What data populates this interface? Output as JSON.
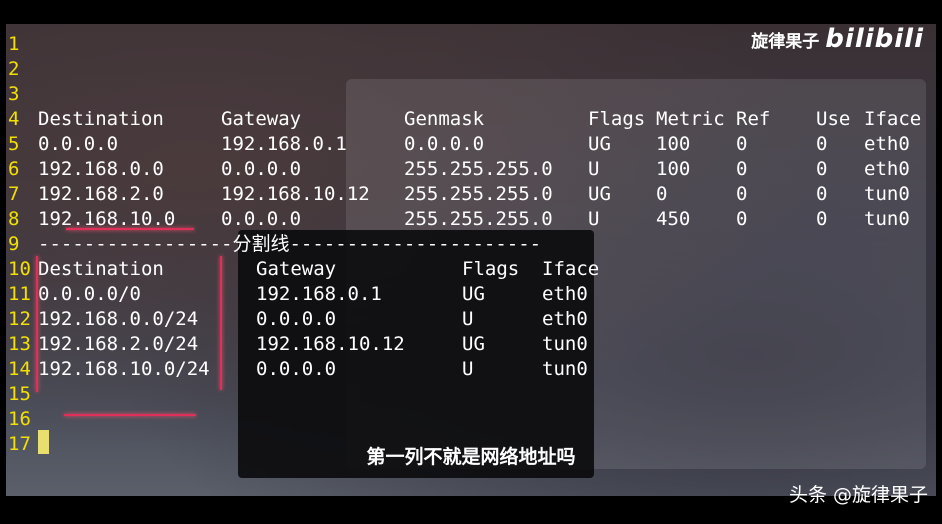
{
  "watermark": {
    "author": "旋律果子",
    "brand": "bilibili"
  },
  "subtitle": "第一列不就是网络地址吗",
  "credit": "头条 @旋律果子",
  "colors": {
    "line_number": "#f2e000",
    "text": "#ffffff",
    "mark": "#e0305a",
    "cursor": "#e8df6e"
  },
  "lines": [
    {
      "n": "1",
      "cells": []
    },
    {
      "n": "2",
      "cells": []
    },
    {
      "n": "3",
      "cells": []
    },
    {
      "n": "4",
      "cells": [
        "Destination",
        "Gateway",
        "Genmask",
        "Flags",
        "Metric",
        "Ref",
        "Use",
        "Iface"
      ]
    },
    {
      "n": "5",
      "cells": [
        "0.0.0.0",
        "192.168.0.1",
        "0.0.0.0",
        "UG",
        "100",
        "0",
        "0",
        "eth0"
      ]
    },
    {
      "n": "6",
      "cells": [
        "192.168.0.0",
        "0.0.0.0",
        "255.255.255.0",
        "U",
        "100",
        "0",
        "0",
        "eth0"
      ]
    },
    {
      "n": "7",
      "cells": [
        "192.168.2.0",
        "192.168.10.12",
        "255.255.255.0",
        "UG",
        "0",
        "0",
        "0",
        "tun0"
      ]
    },
    {
      "n": "8",
      "cells": [
        "192.168.10.0",
        "0.0.0.0",
        "255.255.255.0",
        "U",
        "450",
        "0",
        "0",
        "tun0"
      ]
    },
    {
      "n": "9",
      "cells": [
        "-----------------分割线----------------------"
      ]
    },
    {
      "n": "10",
      "cells": [
        "Destination",
        "Gateway",
        "Flags",
        "Iface"
      ]
    },
    {
      "n": "11",
      "cells": [
        "0.0.0.0/0",
        "192.168.0.1",
        "UG",
        "eth0"
      ]
    },
    {
      "n": "12",
      "cells": [
        "192.168.0.0/24",
        "0.0.0.0",
        "U",
        "eth0"
      ]
    },
    {
      "n": "13",
      "cells": [
        "192.168.2.0/24",
        "192.168.10.12",
        "UG",
        "tun0"
      ]
    },
    {
      "n": "14",
      "cells": [
        "192.168.10.0/24",
        "0.0.0.0",
        "U",
        "tun0"
      ]
    },
    {
      "n": "15",
      "cells": []
    },
    {
      "n": "16",
      "cells": []
    },
    {
      "n": "17",
      "cells": []
    }
  ]
}
